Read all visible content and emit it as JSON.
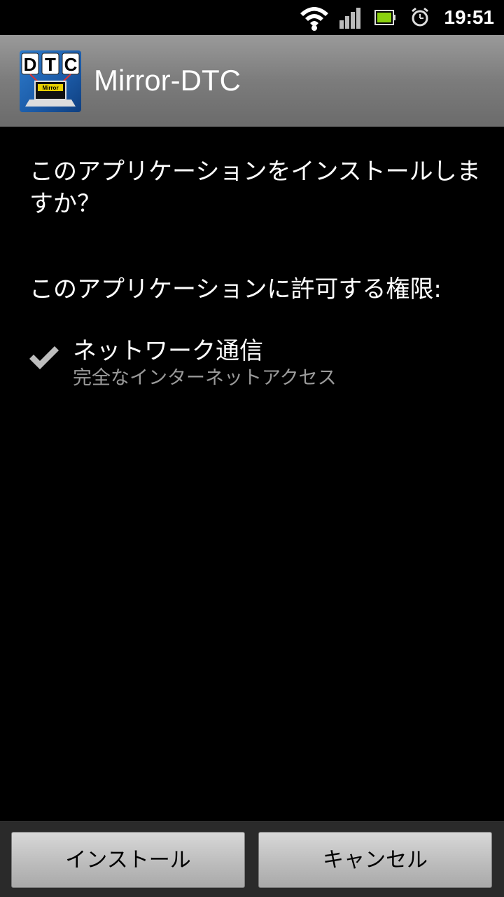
{
  "status_bar": {
    "time": "19:51",
    "icons": [
      "wifi-icon",
      "signal-icon",
      "battery-icon",
      "alarm-icon"
    ]
  },
  "app": {
    "icon_text_top": "DTC",
    "icon_text_screen": "Mirror",
    "title": "Mirror-DTC"
  },
  "content": {
    "question": "このアプリケーションをインストールしますか？",
    "permissions_heading": "このアプリケーションに許可する権限:",
    "permissions": [
      {
        "title": "ネットワーク通信",
        "description": "完全なインターネットアクセス",
        "icon": "check-icon"
      }
    ]
  },
  "buttons": {
    "install": "インストール",
    "cancel": "キャンセル"
  },
  "colors": {
    "background": "#000000",
    "title_bar": "#7c7c7c",
    "secondary_text": "#9a9a9a",
    "button": "#bdbdbd"
  }
}
